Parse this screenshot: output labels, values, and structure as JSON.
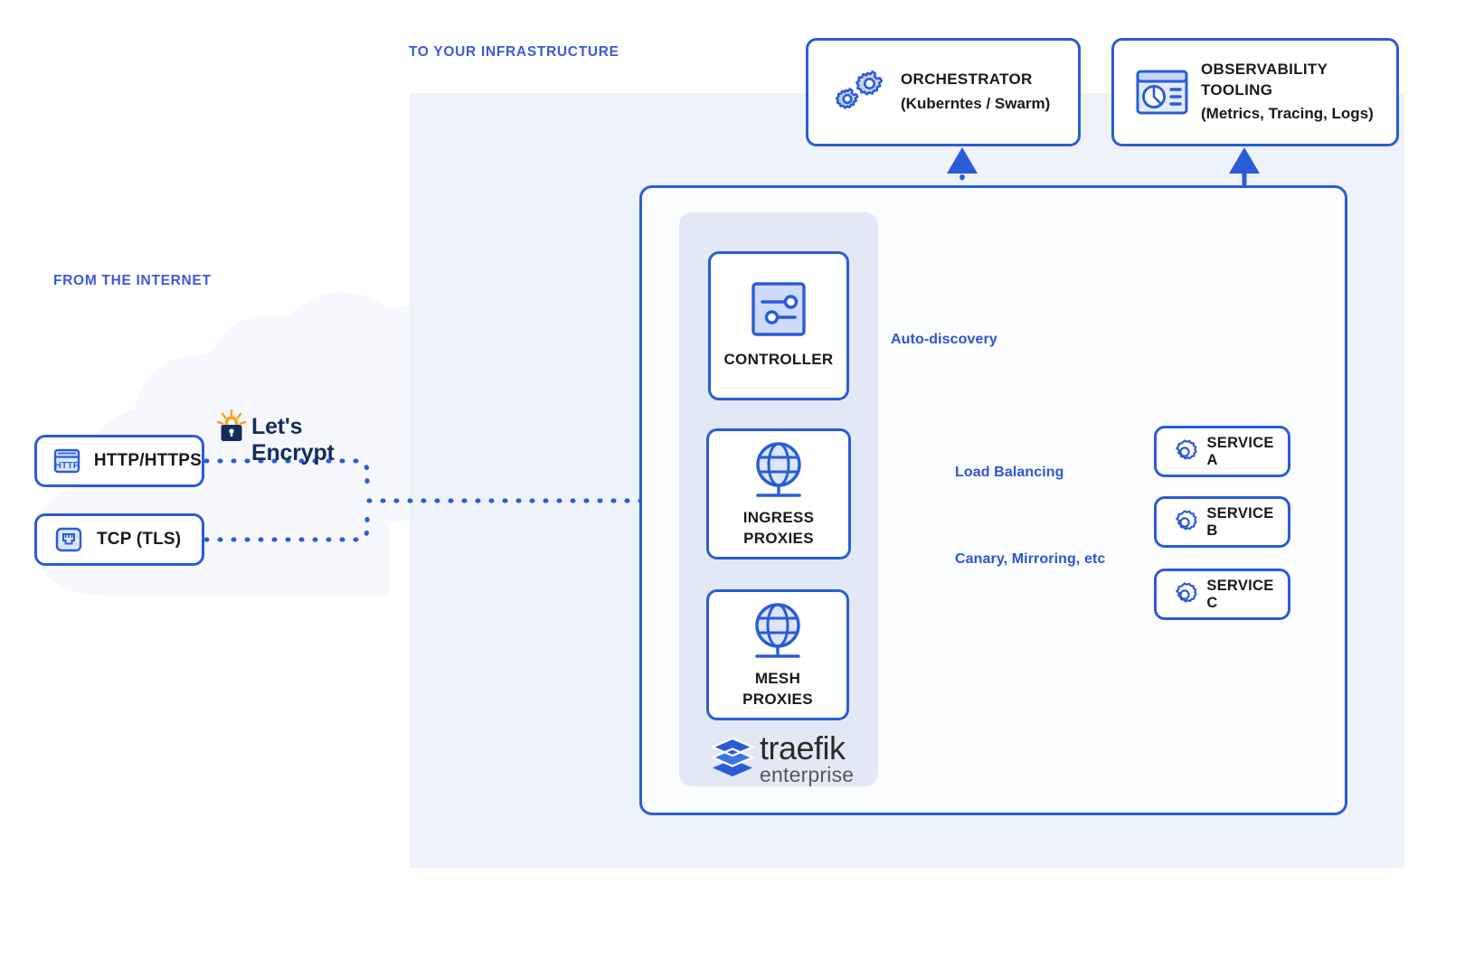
{
  "labels": {
    "internet": "FROM THE INTERNET",
    "infrastructure": "TO YOUR INFRASTRUCTURE"
  },
  "protocols": [
    {
      "name": "HTTP/HTTPS",
      "icon": "http-icon"
    },
    {
      "name": "TCP (TLS)",
      "icon": "ethernet-port-icon"
    }
  ],
  "lets_encrypt": {
    "text": "Let's Encrypt",
    "icon": "lets-encrypt-padlock-icon"
  },
  "top_nodes": [
    {
      "title": "ORCHESTRATOR",
      "subtitle": "(Kuberntes / Swarm)",
      "icon": "gears-icon"
    },
    {
      "title": "OBSERVABILITY",
      "title2": "TOOLING",
      "subtitle": "(Metrics, Tracing, Logs)",
      "icon": "dashboard-chart-icon"
    }
  ],
  "traefik_components": [
    {
      "title": "CONTROLLER",
      "title2": "",
      "icon": "sliders-icon"
    },
    {
      "title": "INGRESS",
      "title2": "PROXIES",
      "icon": "globe-icon"
    },
    {
      "title": "MESH",
      "title2": "PROXIES",
      "icon": "globe-icon"
    }
  ],
  "traefik_logo": {
    "name": "traefik",
    "edition": "enterprise",
    "icon": "traefik-layers-logo"
  },
  "services": [
    {
      "name": "SERVICE A",
      "icon": "gear-icon"
    },
    {
      "name": "SERVICE B",
      "icon": "gear-icon"
    },
    {
      "name": "SERVICE C",
      "icon": "gear-icon"
    }
  ],
  "edge_labels": {
    "auto_discovery": "Auto-discovery",
    "load_balancing": "Load Balancing",
    "canary": "Canary, Mirroring, etc"
  },
  "colors": {
    "primary_blue": "#2a5cd8",
    "label_blue": "#2f54d4",
    "icon_fill": "#c5d3f5",
    "panel_bg": "#e2e8f5",
    "infra_bg": "#eef2fb",
    "navy": "#152c5b",
    "orange": "#f5a623"
  }
}
